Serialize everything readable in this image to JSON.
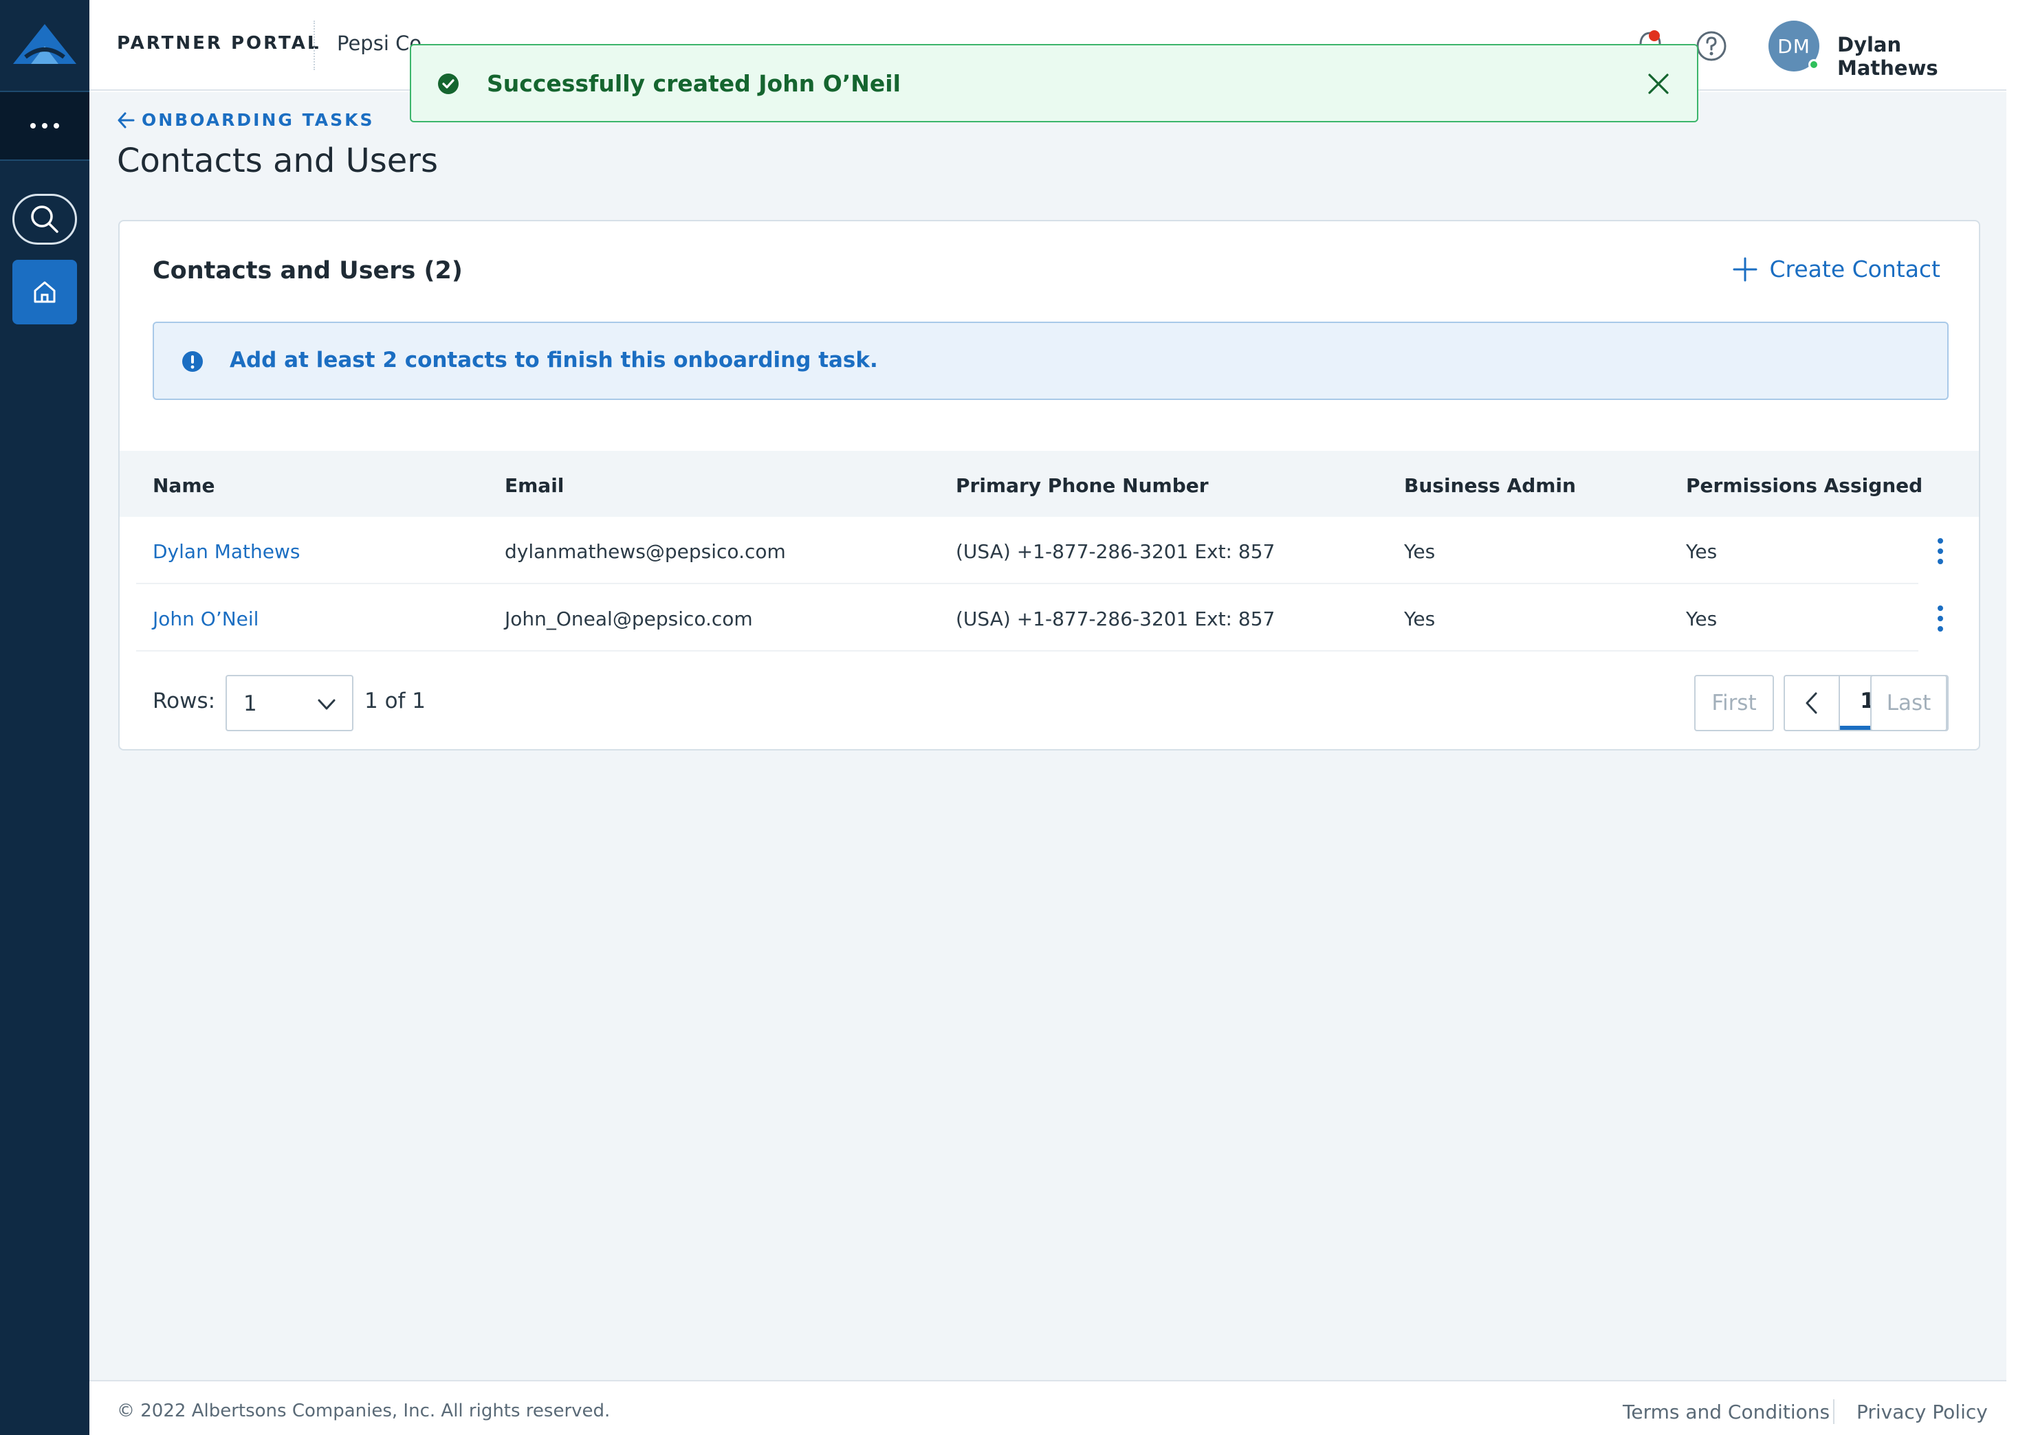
{
  "header": {
    "portal_label": "PARTNER PORTAL",
    "company": "Pepsi Co",
    "user_initials": "DM",
    "user_name": "Dylan Mathews"
  },
  "toast": {
    "message": "Successfully created John O’Neil"
  },
  "breadcrumb": {
    "back_label": "ONBOARDING TASKS"
  },
  "page": {
    "title": "Contacts and Users"
  },
  "card": {
    "title": "Contacts and Users (2)",
    "create_label": "Create Contact",
    "info_message": "Add at least 2 contacts to finish this onboarding task."
  },
  "table": {
    "columns": [
      "Name",
      "Email",
      "Primary Phone Number",
      "Business Admin",
      "Permissions Assigned"
    ],
    "rows": [
      {
        "name": "Dylan Mathews",
        "email": "dylanmathews@pepsico.com",
        "phone": "(USA) +1-877-286-3201  Ext: 857",
        "business_admin": "Yes",
        "permissions": "Yes"
      },
      {
        "name": "John O’Neil",
        "email": "John_Oneal@pepsico.com",
        "phone": "(USA) +1-877-286-3201  Ext: 857",
        "business_admin": "Yes",
        "permissions": "Yes"
      }
    ]
  },
  "pagination": {
    "rows_label": "Rows:",
    "rows_value": "1",
    "range_text": "1 of 1",
    "first_label": "First",
    "current_page": "1",
    "last_label": "Last"
  },
  "footer": {
    "copyright": "© 2022 Albertsons Companies, Inc. All rights reserved.",
    "terms": "Terms and Conditions",
    "privacy": "Privacy Policy"
  },
  "colors": {
    "sidebar": "#0f2a44",
    "accent": "#1b6ec2",
    "success": "#3cb56b",
    "background": "#f1f5f8"
  },
  "icons": [
    "logo-icon",
    "more-icon",
    "search-icon",
    "home-icon",
    "bell-icon",
    "help-icon",
    "check-circle-icon",
    "close-icon",
    "arrow-left-icon",
    "plus-icon",
    "info-icon",
    "kebab-icon",
    "chevron-down-icon",
    "chevron-left-icon",
    "chevron-right-icon"
  ]
}
